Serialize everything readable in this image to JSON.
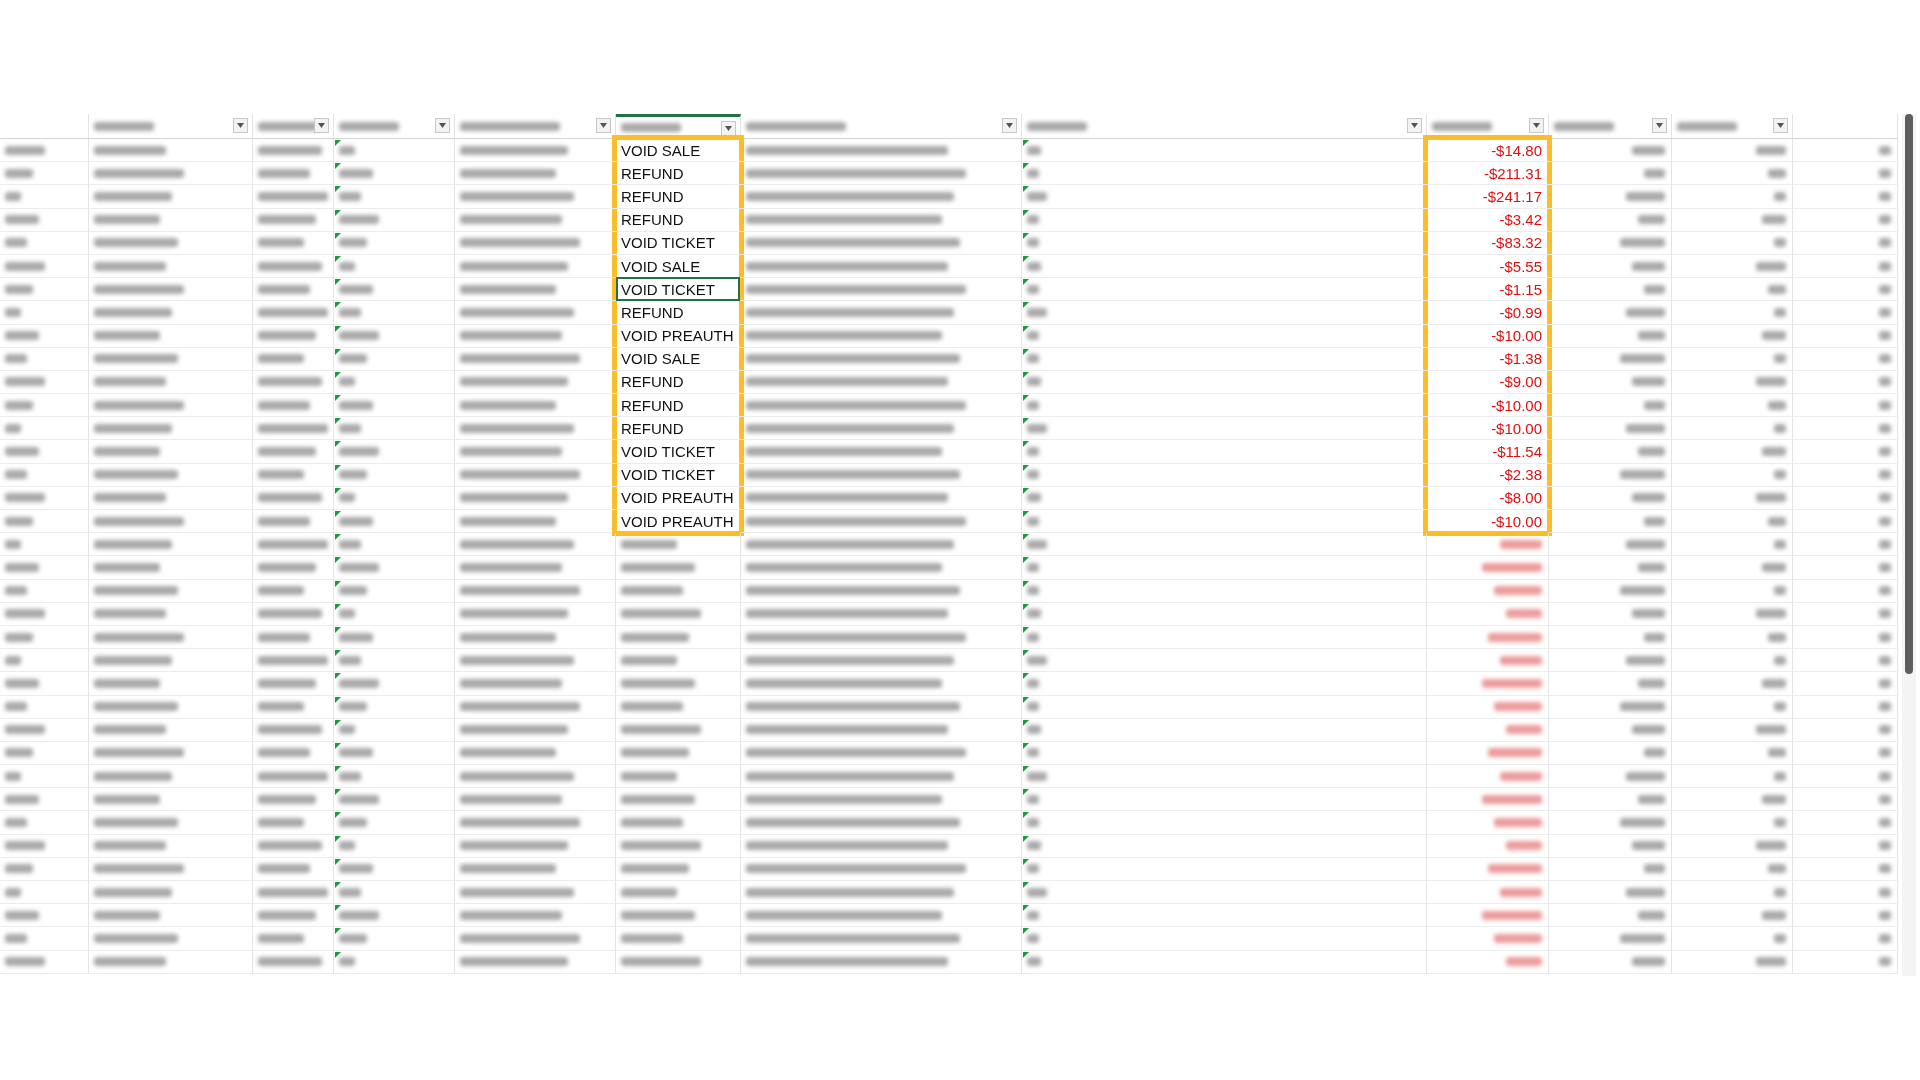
{
  "table": {
    "columns": [
      {
        "kind": "plain"
      },
      {
        "kind": "filter"
      },
      {
        "kind": "filter"
      },
      {
        "kind": "filter"
      },
      {
        "kind": "filter"
      },
      {
        "kind": "transaction"
      },
      {
        "kind": "filter"
      },
      {
        "kind": "filter"
      },
      {
        "kind": "amount"
      },
      {
        "kind": "filter"
      },
      {
        "kind": "filter"
      },
      {
        "kind": "plain"
      }
    ],
    "rows": [
      {
        "kind": "clear",
        "highlighted": true,
        "transaction": "VOID SALE",
        "amount": "-$14.80",
        "selected": false
      },
      {
        "kind": "clear",
        "highlighted": true,
        "transaction": "REFUND",
        "amount": "-$211.31",
        "selected": false
      },
      {
        "kind": "clear",
        "highlighted": true,
        "transaction": "REFUND",
        "amount": "-$241.17",
        "selected": false
      },
      {
        "kind": "clear",
        "highlighted": true,
        "transaction": "REFUND",
        "amount": "-$3.42",
        "selected": false
      },
      {
        "kind": "clear",
        "highlighted": true,
        "transaction": "VOID TICKET",
        "amount": "-$83.32",
        "selected": false
      },
      {
        "kind": "clear",
        "highlighted": true,
        "transaction": "VOID SALE",
        "amount": "-$5.55",
        "selected": false
      },
      {
        "kind": "clear",
        "highlighted": true,
        "transaction": "VOID TICKET",
        "amount": "-$1.15",
        "selected": true
      },
      {
        "kind": "clear",
        "highlighted": true,
        "transaction": "REFUND",
        "amount": "-$0.99",
        "selected": false
      },
      {
        "kind": "clear",
        "highlighted": true,
        "transaction": "VOID PREAUTH",
        "amount": "-$10.00",
        "selected": false
      },
      {
        "kind": "clear",
        "highlighted": true,
        "transaction": "VOID SALE",
        "amount": "-$1.38",
        "selected": false
      },
      {
        "kind": "clear",
        "highlighted": true,
        "transaction": "REFUND",
        "amount": "-$9.00",
        "selected": false
      },
      {
        "kind": "clear",
        "highlighted": true,
        "transaction": "REFUND",
        "amount": "-$10.00",
        "selected": false
      },
      {
        "kind": "clear",
        "highlighted": true,
        "transaction": "REFUND",
        "amount": "-$10.00",
        "selected": false
      },
      {
        "kind": "clear",
        "highlighted": true,
        "transaction": "VOID TICKET",
        "amount": "-$11.54",
        "selected": false
      },
      {
        "kind": "clear",
        "highlighted": true,
        "transaction": "VOID TICKET",
        "amount": "-$2.38",
        "selected": false
      },
      {
        "kind": "clear",
        "highlighted": true,
        "transaction": "VOID PREAUTH",
        "amount": "-$8.00",
        "selected": false
      },
      {
        "kind": "clear",
        "highlighted": true,
        "transaction": "VOID PREAUTH",
        "amount": "-$10.00",
        "selected": false
      },
      {
        "kind": "blurred",
        "highlighted": false
      },
      {
        "kind": "blurred",
        "highlighted": false
      },
      {
        "kind": "blurred",
        "highlighted": false
      },
      {
        "kind": "blurred",
        "highlighted": false
      },
      {
        "kind": "blurred",
        "highlighted": false
      },
      {
        "kind": "blurred",
        "highlighted": false
      },
      {
        "kind": "blurred",
        "highlighted": false
      },
      {
        "kind": "blurred",
        "highlighted": false
      },
      {
        "kind": "blurred",
        "highlighted": false
      },
      {
        "kind": "blurred",
        "highlighted": false
      },
      {
        "kind": "blurred",
        "highlighted": false
      },
      {
        "kind": "blurred",
        "highlighted": false
      },
      {
        "kind": "blurred",
        "highlighted": false
      },
      {
        "kind": "blurred",
        "highlighted": false
      },
      {
        "kind": "blurred",
        "highlighted": false
      },
      {
        "kind": "blurred",
        "highlighted": false
      },
      {
        "kind": "blurred",
        "highlighted": false
      },
      {
        "kind": "blurred",
        "highlighted": false
      },
      {
        "kind": "blurred",
        "highlighted": false
      }
    ]
  }
}
